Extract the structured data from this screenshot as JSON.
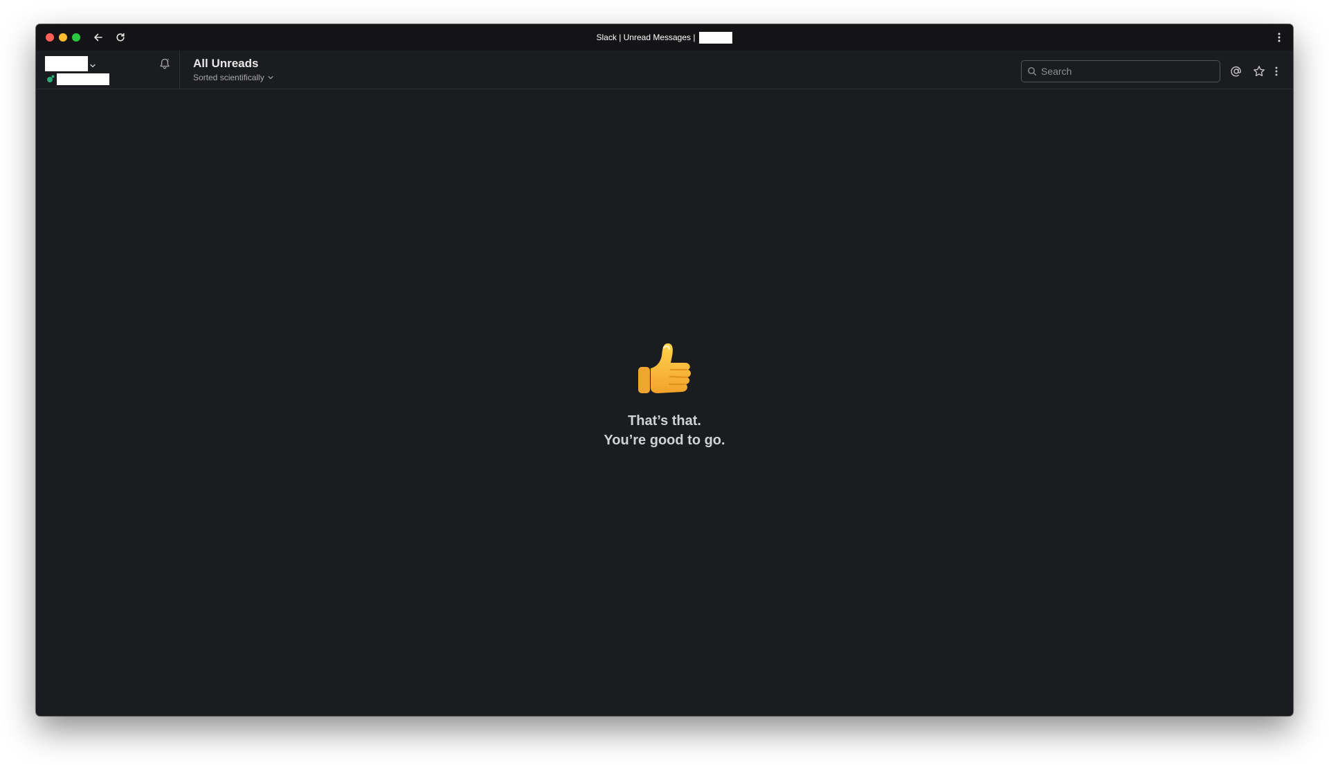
{
  "window": {
    "title": "Slack | Unread Messages |"
  },
  "header": {
    "title": "All Unreads",
    "sort_label": "Sorted scientifically"
  },
  "search": {
    "placeholder": "Search"
  },
  "empty_state": {
    "line1": "That’s that.",
    "line2": "You’re good to go."
  },
  "colors": {
    "background": "#1b1c1f",
    "titlebar": "#141416",
    "presence_active": "#2bac76"
  },
  "icons": [
    "arrow-left-icon",
    "reload-icon",
    "kebab-menu-icon",
    "chevron-down-icon",
    "bell-icon",
    "search-icon",
    "at-sign-icon",
    "star-icon",
    "thumbs-up-icon"
  ]
}
